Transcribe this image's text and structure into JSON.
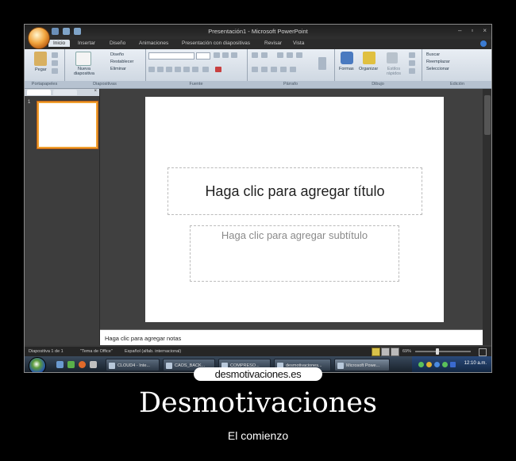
{
  "window": {
    "title": "Presentación1 - Microsoft PowerPoint",
    "controls": [
      "–",
      "▫",
      "×"
    ]
  },
  "ribbon_tabs": [
    "Inicio",
    "Insertar",
    "Diseño",
    "Animaciones",
    "Presentación con diapositivas",
    "Revisar",
    "Vista"
  ],
  "ribbon": {
    "portapapeles": {
      "label": "Portapapeles",
      "paste": "Pegar"
    },
    "diapositivas": {
      "label": "Diapositivas",
      "new_slide": "Nueva diapositiva",
      "design": "Diseño",
      "reset": "Restablecer",
      "delete": "Eliminar"
    },
    "fuente": {
      "label": "Fuente"
    },
    "parrafo": {
      "label": "Párrafo"
    },
    "dibujo": {
      "label": "Dibujo",
      "shapes": "Formas",
      "arrange": "Organizar",
      "quick_styles": "Estilos rápidos"
    },
    "edicion": {
      "label": "Edición",
      "find": "Buscar",
      "replace": "Reemplazar",
      "select": "Seleccionar"
    }
  },
  "slides_pane": {
    "slide_number": "1"
  },
  "slide": {
    "title_placeholder": "Haga clic para agregar título",
    "subtitle_placeholder": "Haga clic para agregar subtítulo"
  },
  "notes": {
    "placeholder": "Haga clic para agregar notas"
  },
  "status_bar": {
    "slide_info": "Diapositiva 1 de 1",
    "theme": "\"Tema de Office\"",
    "language": "Español (alfab. internacional)",
    "zoom": "69%"
  },
  "taskbar": {
    "buttons": [
      "CLOUD4 - Inte...",
      "CAOS_BACK...",
      "COMPRESO...",
      "desmotivaciones...",
      "Microsoft Powe..."
    ],
    "clock": "12:10 a.m."
  },
  "watermark": "desmotivaciones.es",
  "caption": {
    "title": "Desmotivaciones",
    "subtitle": "El comienzo"
  },
  "colors": {
    "poster_background": "#000000",
    "ribbon": "#dfe6ee",
    "thumbnail_selection": "#f0a030"
  }
}
